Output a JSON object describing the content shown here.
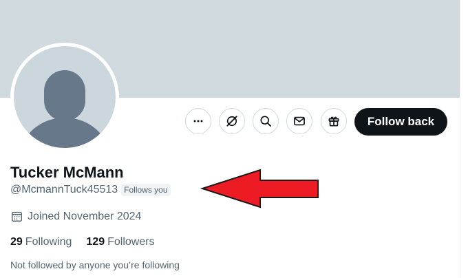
{
  "profile": {
    "name": "Tucker McMann",
    "handle": "@McmannTuck45513",
    "follows_you_badge": "Follows you",
    "joined": "Joined November 2024",
    "following_count": "29",
    "following_label": "Following",
    "followers_count": "129",
    "followers_label": "Followers",
    "not_followed_text": "Not followed by anyone you’re following"
  },
  "actions": {
    "follow_back_label": "Follow back",
    "icons": [
      "more-icon",
      "grok-icon",
      "search-icon",
      "message-icon",
      "gift-icon"
    ]
  },
  "colors": {
    "banner": "#cfd9de",
    "avatar_bg": "#ccd6dd",
    "avatar_silhouette": "#66788a",
    "primary_text": "#0f1419",
    "secondary_text": "#536471",
    "button_bg": "#0f1419",
    "annotation_arrow": "#ed1c24"
  },
  "annotation": {
    "type": "red-arrow",
    "points_to": "follows-you-badge"
  }
}
